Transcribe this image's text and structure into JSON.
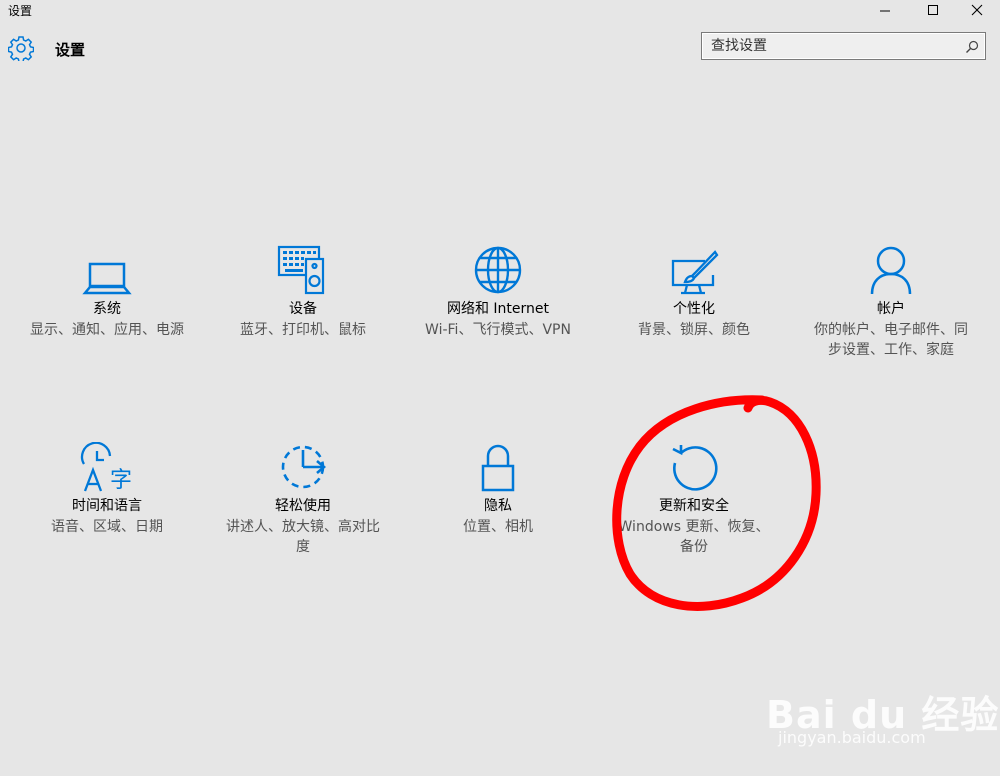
{
  "window": {
    "title": "设置",
    "buttons": {
      "minimize": "minimize-icon",
      "maximize": "maximize-icon",
      "close": "close-icon"
    }
  },
  "header": {
    "title": "设置",
    "icon": "gear-icon"
  },
  "search": {
    "placeholder": "查找设置",
    "value": "",
    "icon": "search-icon"
  },
  "categories": [
    {
      "icon": "laptop-icon",
      "title": "系统",
      "description": "显示、通知、应用、电源"
    },
    {
      "icon": "keyboard-speaker-icon",
      "title": "设备",
      "description": "蓝牙、打印机、鼠标"
    },
    {
      "icon": "globe-icon",
      "title": "网络和 Internet",
      "description": "Wi-Fi、飞行模式、VPN"
    },
    {
      "icon": "personalization-icon",
      "title": "个性化",
      "description": "背景、锁屏、颜色"
    },
    {
      "icon": "person-icon",
      "title": "帐户",
      "description": "你的帐户、电子邮件、同步设置、工作、家庭"
    },
    {
      "icon": "time-language-icon",
      "title": "时间和语言",
      "description": "语音、区域、日期"
    },
    {
      "icon": "ease-of-access-icon",
      "title": "轻松使用",
      "description": "讲述人、放大镜、高对比度"
    },
    {
      "icon": "lock-icon",
      "title": "隐私",
      "description": "位置、相机"
    },
    {
      "icon": "update-icon",
      "title": "更新和安全",
      "description": "Windows 更新、恢复、备份"
    }
  ],
  "watermark": {
    "main": "Bai du 经验",
    "sub": "jingyan.baidu.com"
  },
  "colors": {
    "background": "#e6e6e6",
    "accent": "#0078d7",
    "annotation": "#ff0000"
  }
}
